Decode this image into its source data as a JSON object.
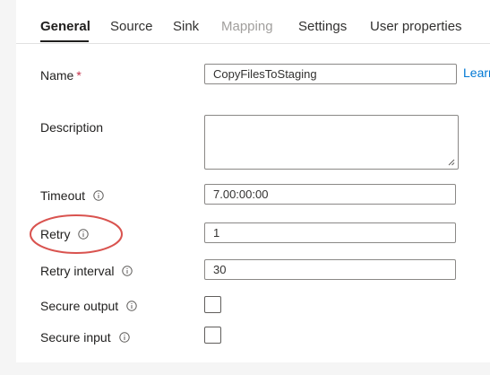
{
  "tabs": [
    {
      "label": "General",
      "state": "active"
    },
    {
      "label": "Source",
      "state": "normal"
    },
    {
      "label": "Sink",
      "state": "normal"
    },
    {
      "label": "Mapping",
      "state": "disabled"
    },
    {
      "label": "Settings",
      "state": "normal"
    },
    {
      "label": "User properties",
      "state": "normal"
    }
  ],
  "form": {
    "name": {
      "label": "Name",
      "required_mark": "*",
      "value": "CopyFilesToStaging",
      "link": "Learn"
    },
    "description": {
      "label": "Description",
      "value": ""
    },
    "timeout": {
      "label": "Timeout",
      "value": "7.00:00:00",
      "icon": "info-icon"
    },
    "retry": {
      "label": "Retry",
      "value": "1",
      "icon": "info-icon"
    },
    "retry_interval": {
      "label": "Retry interval",
      "value": "30",
      "icon": "info-icon"
    },
    "secure_output": {
      "label": "Secure output",
      "checked": false,
      "icon": "info-icon"
    },
    "secure_input": {
      "label": "Secure input",
      "checked": false,
      "icon": "info-icon"
    }
  },
  "annotation": {
    "highlighted_field": "retry",
    "color": "#d9534f"
  },
  "colors": {
    "link": "#0078d4",
    "required": "#c4314b",
    "border": "#8a8886"
  }
}
